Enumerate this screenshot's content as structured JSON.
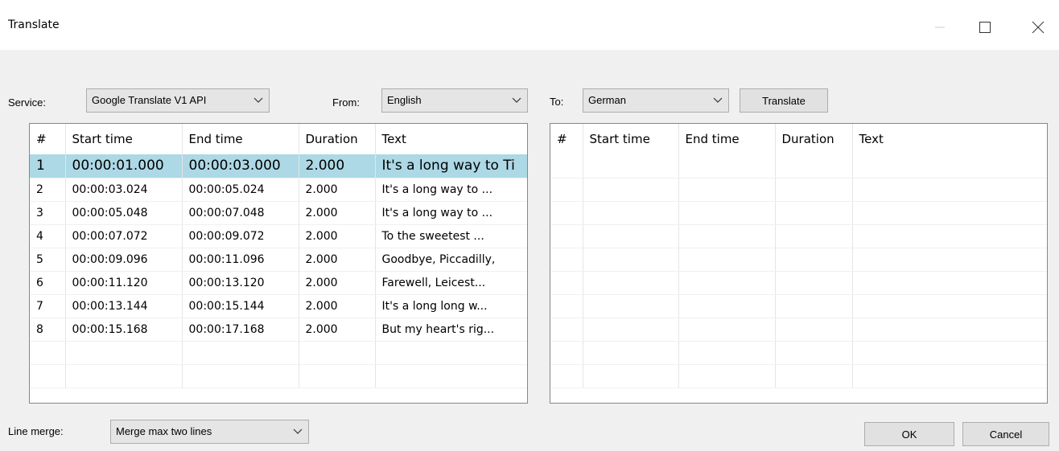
{
  "window": {
    "title": "Translate",
    "controls": [
      "minimize-icon",
      "maximize-icon",
      "close-icon"
    ]
  },
  "toolbar": {
    "service_label": "Service:",
    "service_value": "Google Translate V1 API",
    "from_label": "From:",
    "from_value": "English",
    "to_label": "To:",
    "to_value": "German",
    "translate_label": "Translate"
  },
  "source_grid": {
    "headers": [
      "#",
      "Start time",
      "End time",
      "Duration",
      "Text"
    ],
    "rows": [
      [
        "1",
        "00:00:01.000",
        "00:00:03.000",
        "2.000",
        "It's a long way to Ti"
      ],
      [
        "2",
        "00:00:03.024",
        "00:00:05.024",
        "2.000",
        "It's a long way to ..."
      ],
      [
        "3",
        "00:00:05.048",
        "00:00:07.048",
        "2.000",
        "It's a long way to ..."
      ],
      [
        "4",
        "00:00:07.072",
        "00:00:09.072",
        "2.000",
        "To the sweetest ..."
      ],
      [
        "5",
        "00:00:09.096",
        "00:00:11.096",
        "2.000",
        "Goodbye, Piccadilly,"
      ],
      [
        "6",
        "00:00:11.120",
        "00:00:13.120",
        "2.000",
        "Farewell, Leicest..."
      ],
      [
        "7",
        "00:00:13.144",
        "00:00:15.144",
        "2.000",
        "It's a long long w..."
      ],
      [
        "8",
        "00:00:15.168",
        "00:00:17.168",
        "2.000",
        "But my heart's rig..."
      ]
    ],
    "selected_row": 0
  },
  "target_grid": {
    "headers": [
      "#",
      "Start time",
      "End time",
      "Duration",
      "Text"
    ],
    "rows": []
  },
  "footer": {
    "line_merge_label": "Line merge:",
    "line_merge_value": "Merge max two lines",
    "ok_label": "OK",
    "cancel_label": "Cancel"
  },
  "colors": {
    "selection": "#add8e6",
    "window_bg": "#f0f0f0"
  }
}
